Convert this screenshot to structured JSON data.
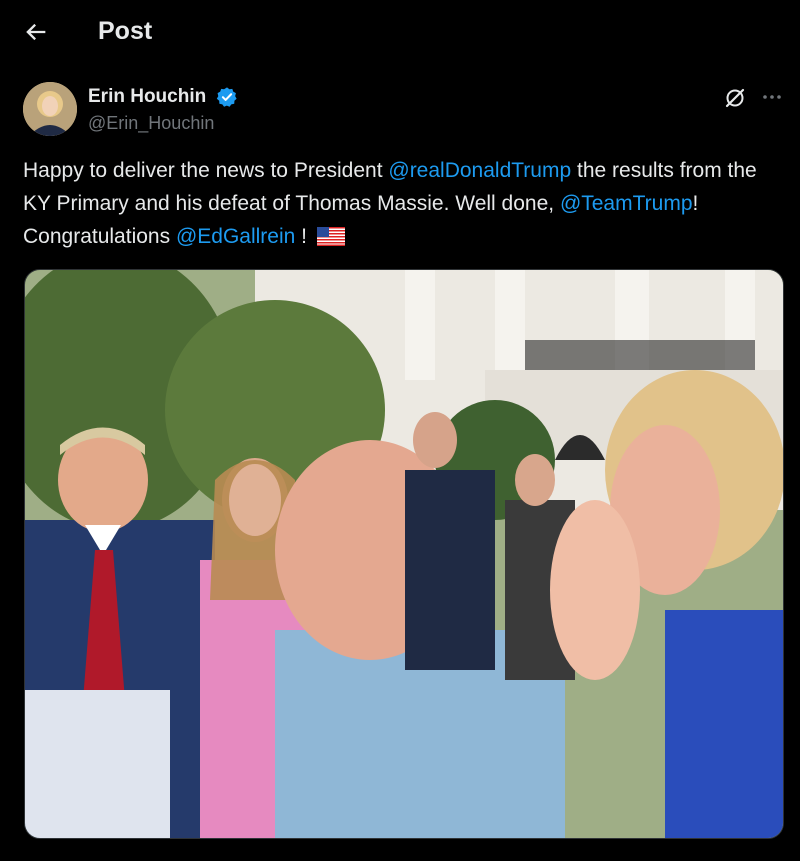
{
  "header": {
    "title": "Post"
  },
  "author": {
    "name": "Erin Houchin",
    "handle": "@Erin_Houchin",
    "verified": true
  },
  "post": {
    "segments": [
      {
        "text": "Happy to deliver the news to President ",
        "type": "text"
      },
      {
        "text": "@realDonaldTrump",
        "type": "mention"
      },
      {
        "text": " the results from the KY Primary and his defeat of Thomas Massie.  Well done, ",
        "type": "text"
      },
      {
        "text": "@TeamTrump",
        "type": "mention"
      },
      {
        "text": "! Congratulations ",
        "type": "text"
      },
      {
        "text": "@EdGallrein",
        "type": "mention"
      },
      {
        "text": " ! ",
        "type": "text"
      }
    ],
    "emoji": "us-flag",
    "media": "photo"
  },
  "colors": {
    "background": "#000000",
    "text": "#e7e9ea",
    "secondary": "#71767b",
    "accent": "#1d9bf0"
  },
  "icons": {
    "back": "arrow-left-icon",
    "verified": "verified-badge-icon",
    "grok": "grok-icon",
    "more": "more-horizontal-icon"
  }
}
